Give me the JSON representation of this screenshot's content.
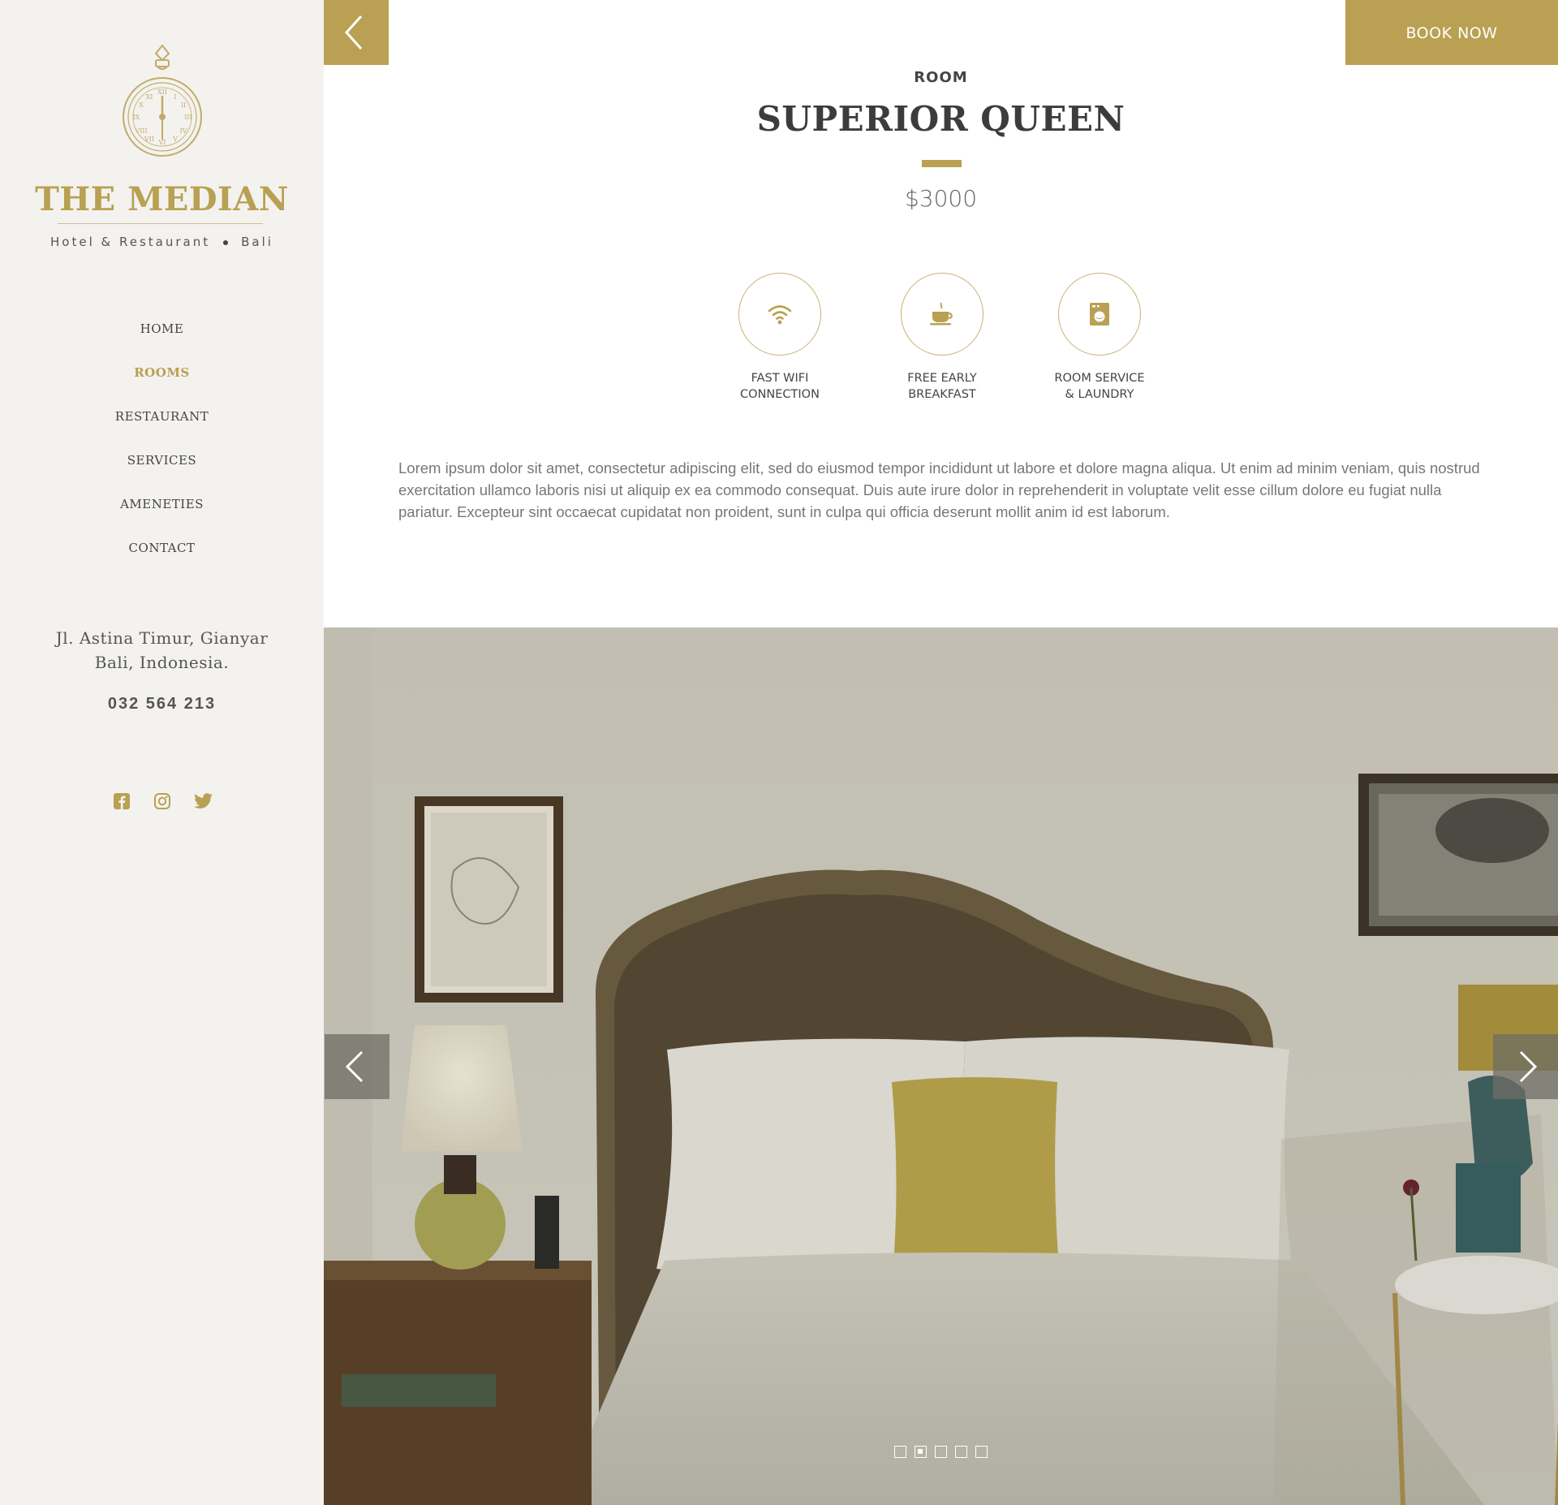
{
  "brand": {
    "name": "THE MEDIAN",
    "tagline_left": "Hotel & Restaurant",
    "tagline_right": "Bali",
    "accent_color": "#b9a052"
  },
  "nav": {
    "items": [
      {
        "label": "HOME",
        "active": false
      },
      {
        "label": "ROOMS",
        "active": true
      },
      {
        "label": "RESTAURANT",
        "active": false
      },
      {
        "label": "SERVICES",
        "active": false
      },
      {
        "label": "AMENETIES",
        "active": false
      },
      {
        "label": "CONTACT",
        "active": false
      }
    ]
  },
  "contact": {
    "address_line1": "Jl. Astina Timur, Gianyar",
    "address_line2": "Bali, Indonesia.",
    "phone": "032 564 213",
    "social": [
      "facebook-icon",
      "instagram-icon",
      "twitter-icon"
    ]
  },
  "header": {
    "back_icon": "chevron-left-icon",
    "book_label": "BOOK NOW"
  },
  "room": {
    "kicker": "ROOM",
    "title": "SUPERIOR QUEEN",
    "price": "$3000",
    "features": [
      {
        "icon": "wifi-icon",
        "label": "FAST WIFI\nCONNECTION"
      },
      {
        "icon": "coffee-cup-icon",
        "label": "FREE EARLY\nBREAKFAST"
      },
      {
        "icon": "washing-machine-icon",
        "label": "ROOM SERVICE\n& LAUNDRY"
      }
    ],
    "description": "Lorem ipsum dolor sit amet, consectetur adipiscing elit, sed do eiusmod tempor incididunt ut labore et dolore magna aliqua. Ut enim ad minim veniam, quis nostrud exercitation ullamco laboris nisi ut aliquip ex ea commodo consequat. Duis aute irure dolor in reprehenderit in voluptate velit esse cillum dolore eu fugiat nulla pariatur. Excepteur sint occaecat cupidatat non proident, sunt in culpa qui officia deserunt mollit anim id est laborum."
  },
  "slider": {
    "slide_count": 5,
    "active_slide": 2,
    "prev_icon": "chevron-left-icon",
    "next_icon": "chevron-right-icon"
  }
}
